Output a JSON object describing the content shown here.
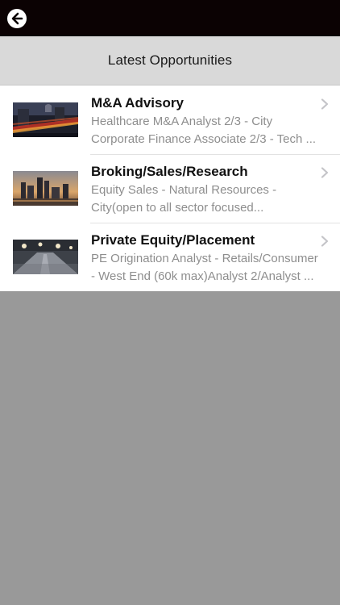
{
  "nav": {
    "back_icon": "arrow-left-circle-icon"
  },
  "header": {
    "title": "Latest Opportunities"
  },
  "colors": {
    "topbar": "#0b0203",
    "header_bg": "#d9d9d9",
    "list_bg": "#ffffff",
    "empty_bg": "#999999",
    "subtitle": "#8e8e8e"
  },
  "items": [
    {
      "title": "M&A Advisory",
      "line1": "Healthcare M&A Analyst 2/3 - City",
      "line2": "Corporate Finance Associate 2/3 - Tech ...",
      "thumbnail": "city-night-traffic-photo"
    },
    {
      "title": "Broking/Sales/Research",
      "line1": "Equity Sales - Natural Resources -",
      "line2": "City(open to all sector focused...",
      "thumbnail": "city-skyline-sunset-photo"
    },
    {
      "title": "Private Equity/Placement",
      "line1": "PE Origination Analyst - Retails/Consumer",
      "line2": "- West End (60k max)Analyst 2/Analyst ...",
      "thumbnail": "road-lights-photo"
    }
  ]
}
